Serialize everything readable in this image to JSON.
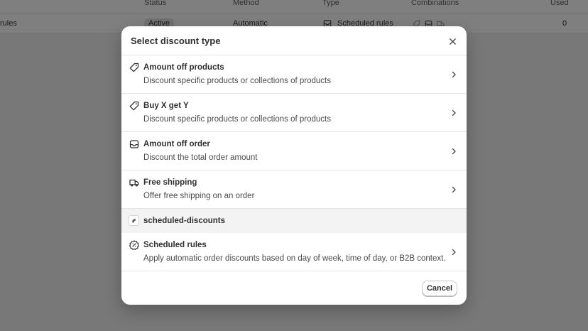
{
  "background": {
    "headers": {
      "status": "Status",
      "method": "Method",
      "type": "Type",
      "combinations": "Combinations",
      "used": "Used"
    },
    "row": {
      "name": "rules",
      "status": "Active",
      "method": "Automatic",
      "type": "Scheduled rules",
      "used": "0"
    }
  },
  "modal": {
    "title": "Select discount type",
    "options": [
      {
        "title": "Amount off products",
        "description": "Discount specific products or collections of products",
        "icon": "tag-icon"
      },
      {
        "title": "Buy X get Y",
        "description": "Discount specific products or collections of products",
        "icon": "tag-icon"
      },
      {
        "title": "Amount off order",
        "description": "Discount the total order amount",
        "icon": "cart-icon"
      },
      {
        "title": "Free shipping",
        "description": "Offer free shipping on an order",
        "icon": "truck-icon"
      }
    ],
    "app_section": {
      "label": "scheduled-discounts",
      "icon": "app-icon"
    },
    "app_options": [
      {
        "title": "Scheduled rules",
        "description": "Apply automatic order discounts based on day of week, time of day, or B2B context.",
        "icon": "discount-badge-icon"
      }
    ],
    "cancel_label": "Cancel"
  }
}
